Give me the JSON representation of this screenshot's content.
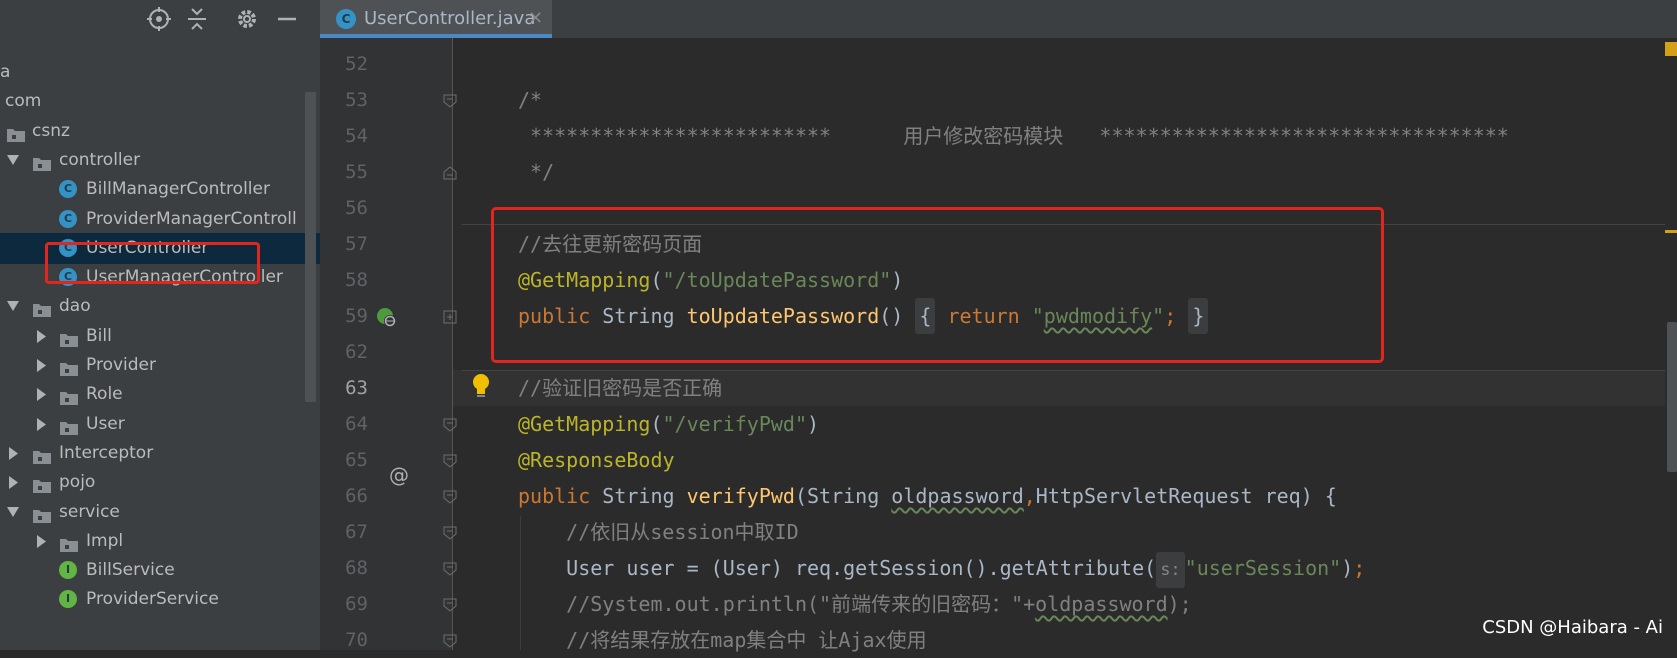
{
  "sidebar": {
    "toolbar_icons": [
      "locate-icon",
      "collapse-all-icon",
      "gear-icon",
      "minimize-icon"
    ],
    "tree": [
      {
        "label": "a",
        "depth": 0,
        "arrow": "none",
        "icon": "none"
      },
      {
        "label": "com",
        "depth": 0,
        "arrow": "none",
        "icon": "none"
      },
      {
        "label": "csnz",
        "depth": 0,
        "arrow": "none",
        "icon": "package"
      },
      {
        "label": "controller",
        "depth": 1,
        "arrow": "down",
        "icon": "package"
      },
      {
        "label": "BillManagerController",
        "depth": 2,
        "arrow": "none",
        "icon": "class"
      },
      {
        "label": "ProviderManagerControll",
        "depth": 2,
        "arrow": "none",
        "icon": "class"
      },
      {
        "label": "UserController",
        "depth": 2,
        "arrow": "none",
        "icon": "class",
        "selected": true
      },
      {
        "label": "UserManagerController",
        "depth": 2,
        "arrow": "none",
        "icon": "class"
      },
      {
        "label": "dao",
        "depth": 1,
        "arrow": "down",
        "icon": "package"
      },
      {
        "label": "Bill",
        "depth": 2,
        "arrow": "right",
        "icon": "package"
      },
      {
        "label": "Provider",
        "depth": 2,
        "arrow": "right",
        "icon": "package"
      },
      {
        "label": "Role",
        "depth": 2,
        "arrow": "right",
        "icon": "package"
      },
      {
        "label": "User",
        "depth": 2,
        "arrow": "right",
        "icon": "package"
      },
      {
        "label": "Interceptor",
        "depth": 1,
        "arrow": "right",
        "icon": "package"
      },
      {
        "label": "pojo",
        "depth": 1,
        "arrow": "right",
        "icon": "package"
      },
      {
        "label": "service",
        "depth": 1,
        "arrow": "down",
        "icon": "package"
      },
      {
        "label": "Impl",
        "depth": 2,
        "arrow": "right",
        "icon": "package"
      },
      {
        "label": "BillService",
        "depth": 2,
        "arrow": "none",
        "icon": "interface"
      },
      {
        "label": "ProviderService",
        "depth": 2,
        "arrow": "none",
        "icon": "interface"
      }
    ]
  },
  "editor": {
    "tab": {
      "label": "UserController.java",
      "close": "×",
      "icon_letter": "C"
    },
    "current_line": "63",
    "lines": [
      {
        "num": "52",
        "tokens": []
      },
      {
        "num": "53",
        "tokens": [
          {
            "t": "/*",
            "c": "comment"
          }
        ]
      },
      {
        "num": "54",
        "tokens": [
          {
            "t": " *************************      用户修改密码模块   **********************************",
            "c": "comment"
          }
        ]
      },
      {
        "num": "55",
        "tokens": [
          {
            "t": " */",
            "c": "comment"
          }
        ]
      },
      {
        "num": "56",
        "tokens": []
      },
      {
        "num": "57",
        "tokens": [
          {
            "t": "//去往更新密码页面",
            "c": "comment"
          }
        ]
      },
      {
        "num": "58",
        "tokens": [
          {
            "t": "@GetMapping",
            "c": "anno"
          },
          {
            "t": "(",
            "c": "plain"
          },
          {
            "t": "\"/toUpdatePassword\"",
            "c": "str"
          },
          {
            "t": ")",
            "c": "plain"
          }
        ]
      },
      {
        "num": "59",
        "tokens": [
          {
            "t": "public ",
            "c": "kw"
          },
          {
            "t": "String ",
            "c": "plain"
          },
          {
            "t": "toUpdatePassword",
            "c": "fn"
          },
          {
            "t": "() ",
            "c": "plain"
          },
          {
            "t": "{",
            "c": "fold"
          },
          {
            "t": " return ",
            "c": "kw"
          },
          {
            "t": "\"",
            "c": "str"
          },
          {
            "t": "pwdmodify",
            "c": "strsq"
          },
          {
            "t": "\"",
            "c": "str"
          },
          {
            "t": "; ",
            "c": "kw"
          },
          {
            "t": "}",
            "c": "fold"
          }
        ]
      },
      {
        "num": "62",
        "tokens": []
      },
      {
        "num": "63",
        "tokens": [
          {
            "t": "//验证旧密码是否正确",
            "c": "comment"
          }
        ]
      },
      {
        "num": "64",
        "tokens": [
          {
            "t": "@GetMapping",
            "c": "anno"
          },
          {
            "t": "(",
            "c": "plain"
          },
          {
            "t": "\"/verifyPwd\"",
            "c": "str"
          },
          {
            "t": ")",
            "c": "plain"
          }
        ]
      },
      {
        "num": "65",
        "tokens": [
          {
            "t": "@ResponseBody",
            "c": "anno"
          }
        ]
      },
      {
        "num": "66",
        "tokens": [
          {
            "t": "public ",
            "c": "kw"
          },
          {
            "t": "String ",
            "c": "plain"
          },
          {
            "t": "verifyPwd",
            "c": "fn"
          },
          {
            "t": "(String ",
            "c": "plain"
          },
          {
            "t": "oldpassword",
            "c": "plainsq"
          },
          {
            "t": ",",
            "c": "kw"
          },
          {
            "t": "HttpServletRequest req) {",
            "c": "plain"
          }
        ]
      },
      {
        "num": "67",
        "tokens": [
          {
            "t": "    //依旧从session中取ID",
            "c": "comment"
          }
        ]
      },
      {
        "num": "68",
        "tokens": [
          {
            "t": "    User user = (User) req.getSession().getAttribute(",
            "c": "plain"
          },
          {
            "t": "s:",
            "c": "hint"
          },
          {
            "t": "\"userSession\"",
            "c": "str"
          },
          {
            "t": ")",
            "c": "plain"
          },
          {
            "t": ";",
            "c": "kw"
          }
        ]
      },
      {
        "num": "69",
        "tokens": [
          {
            "t": "    //System.out.println(\"前端传来的旧密码：\"+",
            "c": "comment"
          },
          {
            "t": "oldpassword",
            "c": "commentsq"
          },
          {
            "t": ");",
            "c": "comment"
          }
        ]
      },
      {
        "num": "70",
        "tokens": [
          {
            "t": "    //将结果存放在map集合中 让Ajax使用",
            "c": "comment"
          }
        ]
      }
    ]
  },
  "watermark": "CSDN @Haibara - Ai",
  "colors": {
    "highlight": "#e0271f",
    "tab_underline": "#4a88c7",
    "keyword": "#cc7832",
    "annotation": "#bbb529",
    "string": "#6a8759",
    "comment": "#808080",
    "function": "#ffc66d"
  }
}
